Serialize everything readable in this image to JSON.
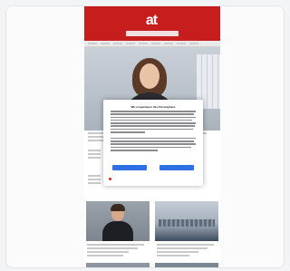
{
  "header": {
    "logo": "at",
    "nav_links": [
      "",
      "",
      "",
      ""
    ],
    "right_link": "",
    "tagline": ""
  },
  "cookie_dialog": {
    "title": "Wir respektieren Ihre Privatsphäre",
    "accept_label": "",
    "settings_label": "",
    "footer_links": [
      "",
      "",
      "",
      "",
      ""
    ]
  },
  "colors": {
    "brand_red": "#c81d1d",
    "button_blue": "#2f6fe4"
  }
}
